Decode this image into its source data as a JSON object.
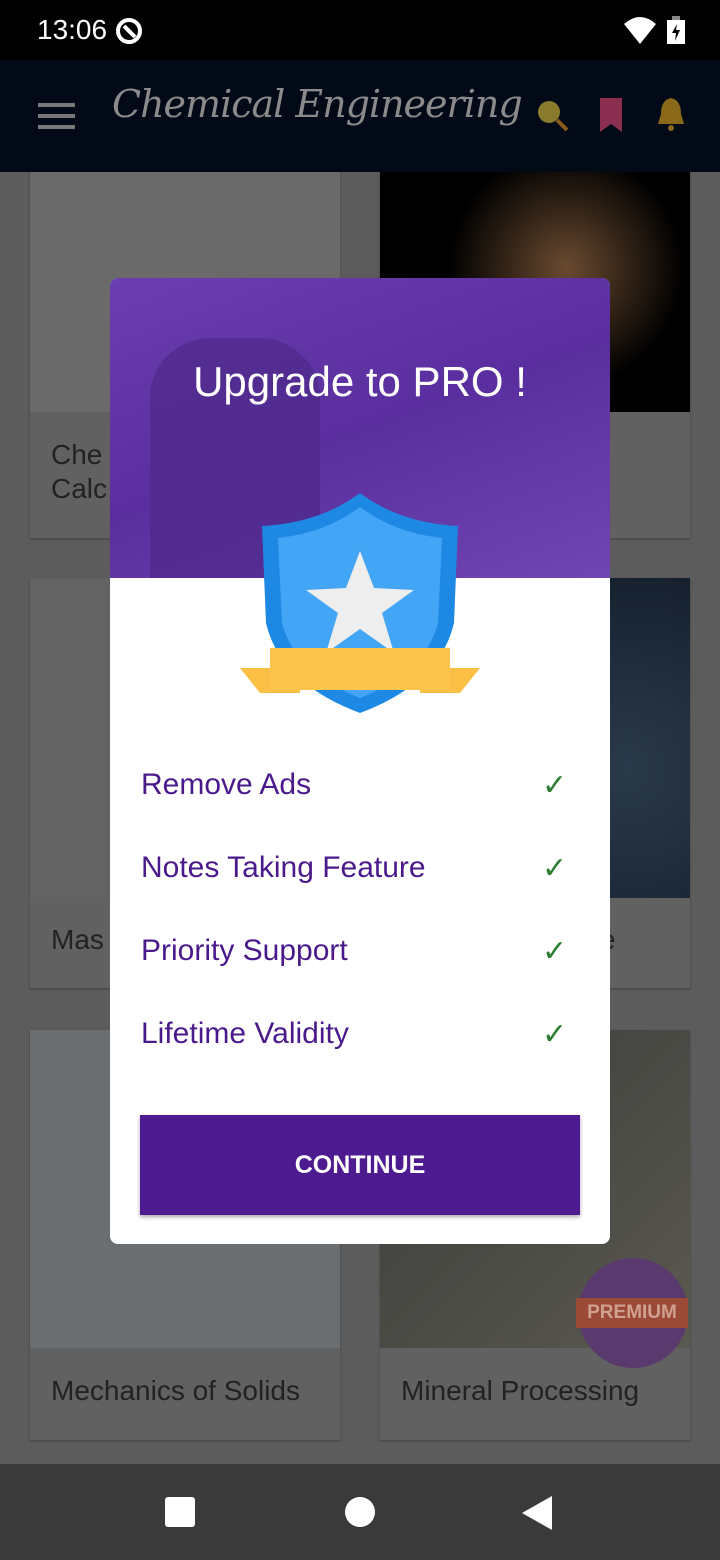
{
  "status_bar": {
    "time": "13:06"
  },
  "app_bar": {
    "title": "Chemical Engineering",
    "icons": [
      "menu-icon",
      "search-icon",
      "bookmark-icon",
      "bell-icon"
    ]
  },
  "cards": [
    {
      "label": "Che\nCalc"
    },
    {
      "label": ""
    },
    {
      "label": "Mas"
    },
    {
      "label": "e"
    },
    {
      "label": "Mechanics of Solids"
    },
    {
      "label": "Mineral Processing"
    }
  ],
  "dialog": {
    "title": "Upgrade to PRO !",
    "features": [
      "Remove Ads",
      "Notes Taking Feature",
      "Priority Support",
      "Lifetime Validity"
    ],
    "continue_label": "CONTINUE",
    "accent": "#4e1a8f",
    "check_color": "#2e7d32"
  },
  "premium_badge": {
    "label": "PREMIUM"
  }
}
